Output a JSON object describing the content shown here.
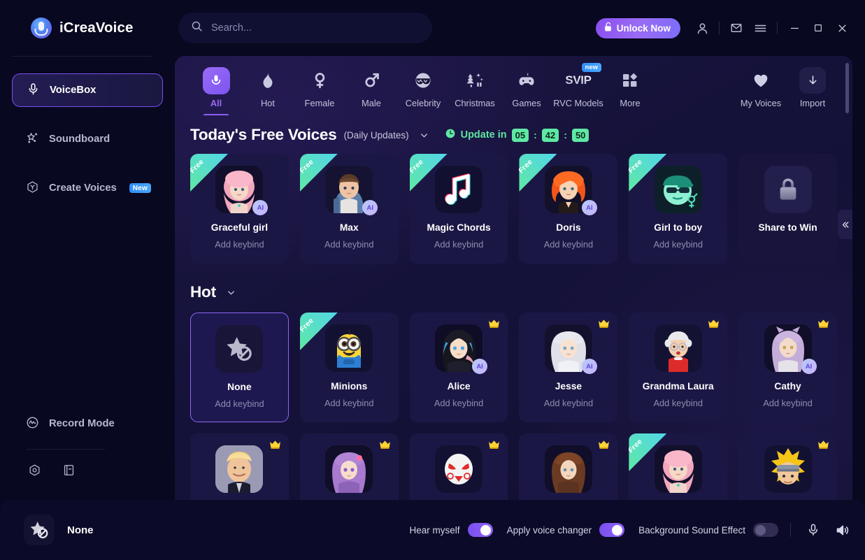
{
  "app": {
    "brand": "iCreaVoice",
    "logo_icon": "headphone-mic-icon"
  },
  "search": {
    "placeholder": "Search...",
    "value": "",
    "icon": "search-icon"
  },
  "header": {
    "unlock_label": "Unlock Now",
    "unlock_icon": "unlock-padlock-icon",
    "unlock_color": "#8a4ff0",
    "account_icon": "user-icon",
    "mail_icon": "envelope-icon",
    "menu_icon": "hamburger-menu-icon",
    "minimize_icon": "minimize-icon",
    "maximize_icon": "maximize-icon",
    "close_icon": "close-icon"
  },
  "sidebar": {
    "items": [
      {
        "label": "VoiceBox",
        "icon": "microphone-icon",
        "active": true,
        "badge": null
      },
      {
        "label": "Soundboard",
        "icon": "magic-star-icon",
        "active": false,
        "badge": null
      },
      {
        "label": "Create Voices",
        "icon": "hexagon-y-icon",
        "active": false,
        "badge": "New"
      }
    ],
    "record_mode": {
      "label": "Record Mode",
      "icon": "waveform-circle-icon"
    },
    "bottom_icons": [
      {
        "name": "settings-hexagon-icon"
      },
      {
        "name": "notebook-icon"
      }
    ]
  },
  "categories": [
    {
      "label": "All",
      "icon": "microphone-tile-icon",
      "active": true,
      "badge": null
    },
    {
      "label": "Hot",
      "icon": "flame-icon",
      "active": false,
      "badge": null
    },
    {
      "label": "Female",
      "icon": "venus-icon",
      "active": false,
      "badge": null
    },
    {
      "label": "Male",
      "icon": "mars-icon",
      "active": false,
      "badge": null
    },
    {
      "label": "Celebrity",
      "icon": "sunglasses-icon",
      "active": false,
      "badge": null
    },
    {
      "label": "Christmas",
      "icon": "christmas-tree-icon",
      "active": false,
      "badge": null
    },
    {
      "label": "Games",
      "icon": "gamepad-icon",
      "active": false,
      "badge": null
    },
    {
      "label": "RVC Models",
      "icon": "svip-text-icon",
      "active": false,
      "badge": "new"
    },
    {
      "label": "More",
      "icon": "grid-squares-icon",
      "active": false,
      "badge": null
    }
  ],
  "categories_right": [
    {
      "label": "My Voices",
      "icon": "heart-icon"
    },
    {
      "label": "Import",
      "icon": "download-arrow-icon"
    }
  ],
  "sections": [
    {
      "title": "Today's Free Voices",
      "subtitle": "(Daily Updates)",
      "chevron_icon": "chevron-down-icon",
      "timer": {
        "icon": "clock-icon",
        "label": "Update in",
        "hours": "05",
        "minutes": "42",
        "seconds": "50",
        "color": "#5fe8a4"
      },
      "cards": [
        {
          "name": "Graceful girl",
          "keybind": "Add keybind",
          "free": true,
          "ai": true,
          "vip": false,
          "art": "pink-hair-girl",
          "emoji": ""
        },
        {
          "name": "Max",
          "keybind": "Add keybind",
          "free": true,
          "ai": true,
          "vip": false,
          "art": "brown-hair-boy",
          "emoji": ""
        },
        {
          "name": "Magic Chords",
          "keybind": "Add keybind",
          "free": true,
          "ai": false,
          "vip": false,
          "art": "music-note",
          "emoji": "♫"
        },
        {
          "name": "Doris",
          "keybind": "Add keybind",
          "free": true,
          "ai": true,
          "vip": false,
          "art": "red-hair-girl",
          "emoji": ""
        },
        {
          "name": "Girl to boy",
          "keybind": "Add keybind",
          "free": true,
          "ai": false,
          "vip": false,
          "art": "green-cap-face",
          "emoji": ""
        },
        {
          "name": "Share to Win",
          "keybind": "",
          "free": false,
          "ai": false,
          "vip": false,
          "art": "lock",
          "emoji": "🔒"
        }
      ]
    },
    {
      "title": "Hot",
      "subtitle": "",
      "chevron_icon": "chevron-down-icon",
      "timer": null,
      "cards": [
        {
          "name": "None",
          "keybind": "Add keybind",
          "free": false,
          "ai": false,
          "vip": false,
          "selected": true,
          "art": "star-none",
          "emoji": ""
        },
        {
          "name": "Minions",
          "keybind": "Add keybind",
          "free": true,
          "ai": false,
          "vip": false,
          "art": "minion",
          "emoji": ""
        },
        {
          "name": "Alice",
          "keybind": "Add keybind",
          "free": false,
          "ai": true,
          "vip": true,
          "art": "blue-black-hair-girl",
          "emoji": ""
        },
        {
          "name": "Jesse",
          "keybind": "Add keybind",
          "free": false,
          "ai": true,
          "vip": true,
          "art": "silver-hair-girl",
          "emoji": ""
        },
        {
          "name": "Grandma Laura",
          "keybind": "Add keybind",
          "free": false,
          "ai": false,
          "vip": true,
          "art": "grandma",
          "emoji": "👵"
        },
        {
          "name": "Cathy",
          "keybind": "Add keybind",
          "free": false,
          "ai": true,
          "vip": true,
          "art": "purple-hair-girl",
          "emoji": ""
        }
      ]
    },
    {
      "title": "",
      "subtitle": "",
      "chevron_icon": "",
      "timer": null,
      "partial": true,
      "cards": [
        {
          "name": "",
          "keybind": "",
          "free": false,
          "ai": false,
          "vip": true,
          "art": "trump",
          "emoji": ""
        },
        {
          "name": "",
          "keybind": "",
          "free": false,
          "ai": false,
          "vip": true,
          "art": "purple-anime-girl",
          "emoji": ""
        },
        {
          "name": "",
          "keybind": "",
          "free": false,
          "ai": false,
          "vip": true,
          "art": "white-mask",
          "emoji": ""
        },
        {
          "name": "",
          "keybind": "",
          "free": false,
          "ai": false,
          "vip": true,
          "art": "brown-curly-girl",
          "emoji": ""
        },
        {
          "name": "",
          "keybind": "",
          "free": true,
          "ai": false,
          "vip": false,
          "art": "pink-hair-girl2",
          "emoji": ""
        },
        {
          "name": "",
          "keybind": "",
          "free": false,
          "ai": false,
          "vip": true,
          "art": "naruto",
          "emoji": ""
        }
      ]
    }
  ],
  "collapse_button": {
    "icon": "double-chevron-left-icon"
  },
  "bottom_bar": {
    "current_voice": {
      "name": "None",
      "icon": "star-none-icon"
    },
    "controls": [
      {
        "label": "Hear myself",
        "on": true
      },
      {
        "label": "Apply voice changer",
        "on": true
      },
      {
        "label": "Background Sound Effect",
        "on": false
      }
    ],
    "mic_icon": "microphone-icon",
    "speaker_icon": "speaker-icon"
  }
}
